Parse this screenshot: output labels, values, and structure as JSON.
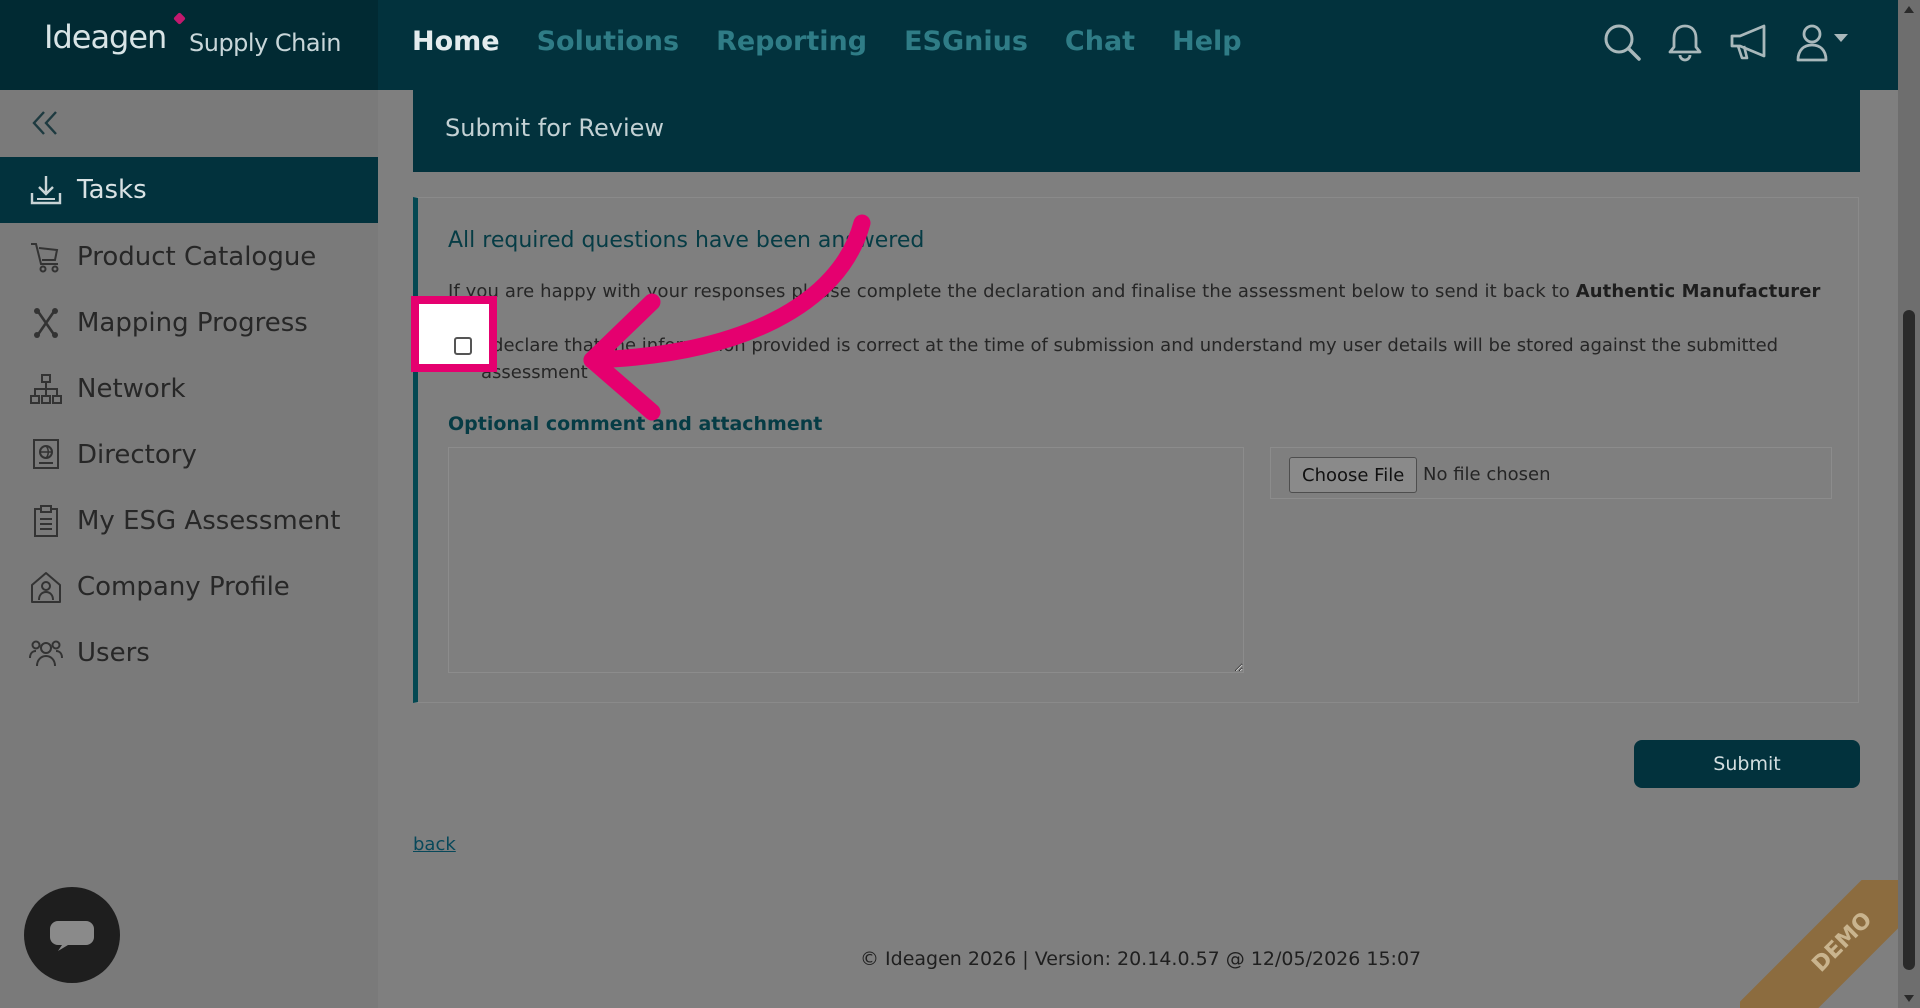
{
  "brand": {
    "logo": "Ideagen",
    "product": "Supply Chain"
  },
  "nav": {
    "items": [
      "Home",
      "Solutions",
      "Reporting",
      "ESGnius",
      "Chat",
      "Help"
    ],
    "active": "Home"
  },
  "top_icons": [
    "search-icon",
    "bell-icon",
    "megaphone-icon",
    "user-menu-icon"
  ],
  "sidebar": {
    "items": [
      {
        "label": "Tasks",
        "icon": "tray-download-icon",
        "active": true
      },
      {
        "label": "Product Catalogue",
        "icon": "cart-icon"
      },
      {
        "label": "Mapping Progress",
        "icon": "mapping-icon"
      },
      {
        "label": "Network",
        "icon": "network-icon"
      },
      {
        "label": "Directory",
        "icon": "directory-icon"
      },
      {
        "label": "My ESG Assessment",
        "icon": "clipboard-icon"
      },
      {
        "label": "Company Profile",
        "icon": "company-icon"
      },
      {
        "label": "Users",
        "icon": "users-icon"
      }
    ]
  },
  "panel": {
    "title": "Submit for Review",
    "status": "All required questions have been answered",
    "intro": "If you are happy with your responses please complete the declaration and finalise the assessment below to send it back to ",
    "recipient": "Authentic Manufacturer",
    "declaration": "I declare that the information provided is correct at the time of submission and understand my user details will be stored against the submitted assessment",
    "declaration_checked": false,
    "optional_heading": "Optional comment and attachment",
    "file_button": "Choose File",
    "file_status": "No file chosen",
    "submit": "Submit",
    "back": "back"
  },
  "footer": "© Ideagen 2026 | Version: 20.14.0.57 @ 12/05/2026 15:07",
  "ribbon": "DEMO",
  "colors": {
    "brand_dark": "#02323d",
    "accent": "#034852",
    "highlight": "#e5006f"
  }
}
